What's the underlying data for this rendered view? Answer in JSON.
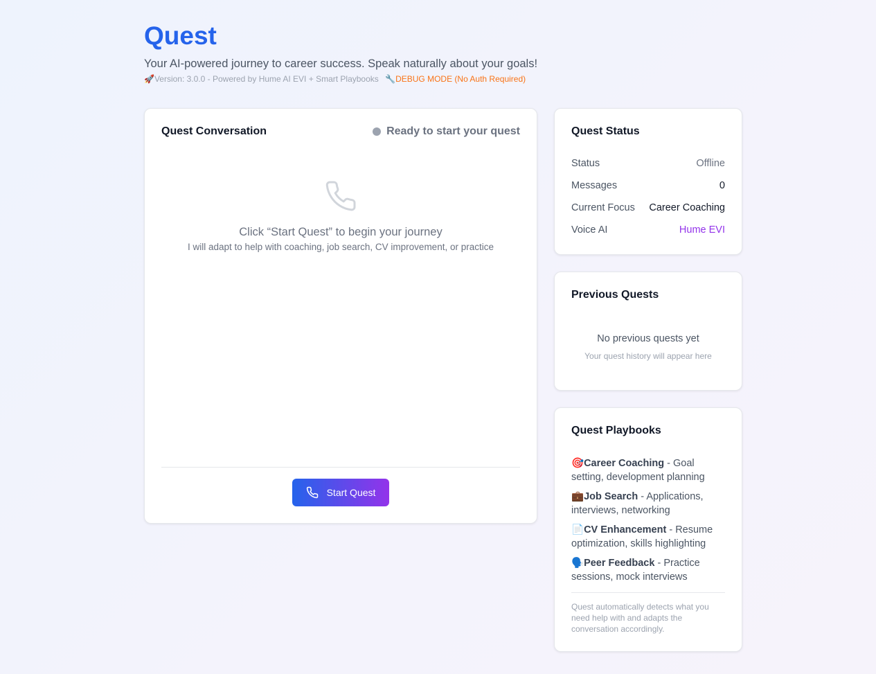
{
  "app": {
    "title": "Quest",
    "subtitle": "Your AI-powered journey to career success. Speak naturally about your goals!",
    "version": "🚀Version: 3.0.0 - Powered by Hume AI EVI + Smart Playbooks",
    "debug_icon": "🔧",
    "debug": "DEBUG MODE (No Auth Required)"
  },
  "conversation": {
    "title": "Quest Conversation",
    "state": "Ready to start your quest",
    "empty_title": "Click “Start Quest” to begin your journey",
    "empty_sub": "I will adapt to help with coaching, job search, CV improvement, or practice",
    "start_button": "Start Quest",
    "icon": "phone-icon"
  },
  "status": {
    "title": "Quest Status",
    "rows": [
      {
        "label": "Status",
        "value": "Offline"
      },
      {
        "label": "Messages",
        "value": "0"
      },
      {
        "label": "Current Focus",
        "value": "Career Coaching"
      },
      {
        "label": "Voice AI",
        "value": "Hume EVI"
      }
    ]
  },
  "previous": {
    "title": "Previous Quests",
    "empty_title": "No previous quests yet",
    "empty_sub": "Your quest history will appear here"
  },
  "playbooks": {
    "title": "Quest Playbooks",
    "items": [
      {
        "emoji": "🎯",
        "name": "Career Coaching",
        "desc": " - Goal setting, development planning"
      },
      {
        "emoji": "💼",
        "name": "Job Search",
        "desc": " - Applications, interviews, networking"
      },
      {
        "emoji": "📄",
        "name": "CV Enhancement",
        "desc": " - Resume optimization, skills highlighting"
      },
      {
        "emoji": "🗣️",
        "name": "Peer Feedback",
        "desc": " - Practice sessions, mock interviews"
      }
    ],
    "note": "Quest automatically detects what you need help with and adapts the conversation accordingly."
  },
  "colors": {
    "primary": "#2563eb",
    "accent": "#9333ea",
    "debug": "#f97316"
  }
}
